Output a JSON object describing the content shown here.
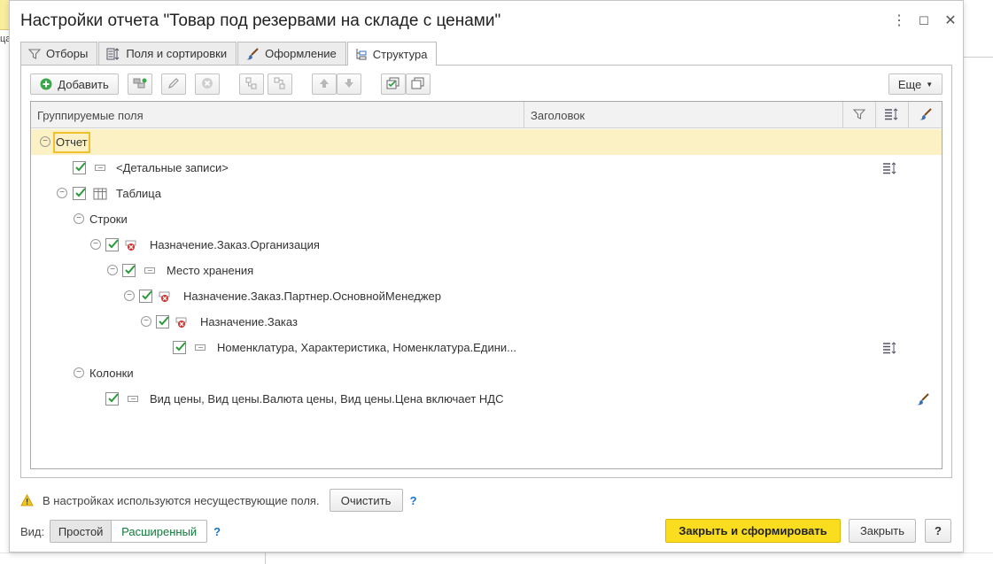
{
  "background": {
    "left_text": "ца"
  },
  "window": {
    "title": "Настройки отчета \"Товар под резервами на складе с ценами\"",
    "controls": {
      "more": "⋮",
      "maximize": "☐",
      "close": "✕"
    }
  },
  "tabs": [
    {
      "label": "Отборы",
      "icon": "filter-icon"
    },
    {
      "label": "Поля и сортировки",
      "icon": "fields-sort-icon"
    },
    {
      "label": "Оформление",
      "icon": "brush-icon"
    },
    {
      "label": "Структура",
      "icon": "structure-icon",
      "active": true
    }
  ],
  "toolbar": {
    "add_label": "Добавить",
    "more_label": "Еще"
  },
  "grid": {
    "col_grouped": "Группируемые поля",
    "col_header": "Заголовок",
    "rows": [
      {
        "text": "Отчет"
      },
      {
        "text": "<Детальные записи>"
      },
      {
        "text": "Таблица"
      },
      {
        "text": "Строки"
      },
      {
        "text": "Назначение.Заказ.Организация"
      },
      {
        "text": "Место хранения"
      },
      {
        "text": "Назначение.Заказ.Партнер.ОсновнойМенеджер"
      },
      {
        "text": "Назначение.Заказ"
      },
      {
        "text": "Номенклатура, Характеристика, Номенклатура.Едини..."
      },
      {
        "text": "Колонки"
      },
      {
        "text": "Вид цены, Вид цены.Валюта цены, Вид цены.Цена включает НДС"
      }
    ]
  },
  "warning": {
    "text": "В настройках используются несуществующие поля.",
    "clear_label": "Очистить",
    "help": "?"
  },
  "footer": {
    "view_label": "Вид:",
    "simple_label": "Простой",
    "extended_label": "Расширенный",
    "help": "?",
    "generate_label": "Закрыть и сформировать",
    "close_label": "Закрыть",
    "help2": "?"
  },
  "colors": {
    "accent": "#f5d51e",
    "selected_row": "#fbf1c5",
    "check": "#2a9a3a",
    "error_icon": "#d32f2f"
  }
}
